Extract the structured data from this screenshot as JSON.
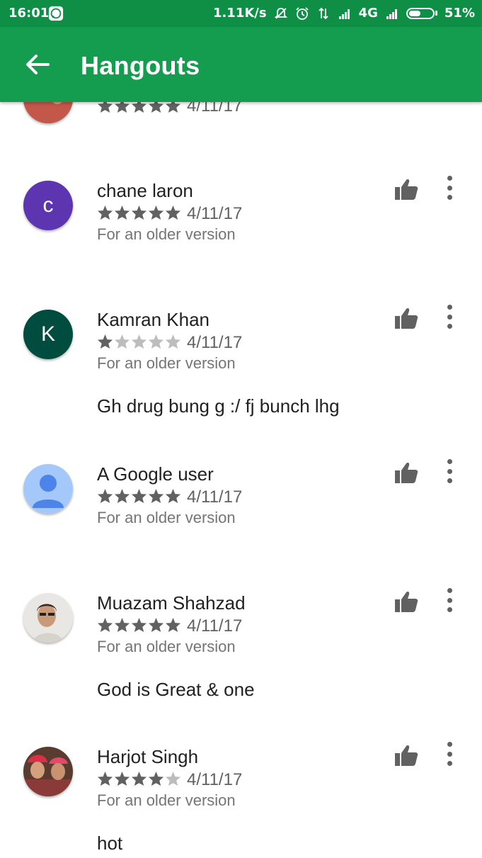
{
  "status_bar": {
    "time": "16:01",
    "network_speed": "1.11K/s",
    "network_type": "4G",
    "battery_percent": "51%",
    "battery_level": 0.51
  },
  "app_bar": {
    "title": "Hangouts",
    "back_icon": "arrow-left-icon"
  },
  "reviews": [
    {
      "name": "",
      "rating": 5,
      "date": "4/11/17",
      "version_note": "",
      "text": "",
      "avatar": "photo"
    },
    {
      "name": "chane laron",
      "rating": 5,
      "date": "4/11/17",
      "version_note": "For an older version",
      "text": "",
      "avatar_letter": "c",
      "avatar_color": "#5e35b1"
    },
    {
      "name": "Kamran Khan",
      "rating": 1,
      "date": "4/11/17",
      "version_note": "For an older version",
      "text": "Gh drug bung g :/ fj bunch lhg",
      "avatar_letter": "K",
      "avatar_color": "#004d40"
    },
    {
      "name": "A Google user",
      "rating": 5,
      "date": "4/11/17",
      "version_note": "For an older version",
      "text": "",
      "avatar": "default-user"
    },
    {
      "name": "Muazam Shahzad",
      "rating": 5,
      "date": "4/11/17",
      "version_note": "For an older version",
      "text": "God is Great & one",
      "avatar": "photo"
    },
    {
      "name": "Harjot Singh",
      "rating": 4,
      "date": "4/11/17",
      "version_note": "For an older version",
      "text": "hot",
      "avatar": "photo"
    }
  ],
  "colors": {
    "status_bar": "#0f8f46",
    "app_bar": "#149c4f",
    "star_filled": "#616161",
    "star_empty": "#bdbdbd"
  }
}
